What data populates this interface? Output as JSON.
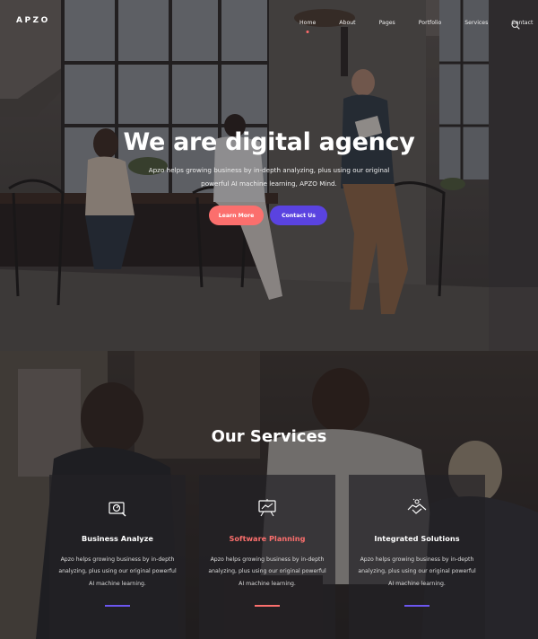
{
  "brand": {
    "logo": "APZO"
  },
  "nav": {
    "items": [
      {
        "label": "Home",
        "active": true
      },
      {
        "label": "About",
        "active": false
      },
      {
        "label": "Pages",
        "active": false
      },
      {
        "label": "Portfolio",
        "active": false
      },
      {
        "label": "Services",
        "active": false
      },
      {
        "label": "Contact",
        "active": false
      }
    ],
    "search_icon": "search-icon"
  },
  "hero": {
    "title": "We are digital agency",
    "description": "Apzo helps growing business by in-depth analyzing, plus using our original powerful AI machine learning, APZO Mind.",
    "learn_more": "Learn More",
    "contact_us": "Contact Us"
  },
  "services": {
    "title": "Our Services",
    "cards": [
      {
        "icon": "analytics-icon",
        "title": "Business Analyze",
        "description": "Apzo helps growing business by in-depth analyzing, plus using our original powerful AI machine learning."
      },
      {
        "icon": "planning-board-icon",
        "title": "Software Planning",
        "description": "Apzo helps growing business by in-depth analyzing, plus using our original powerful AI machine learning."
      },
      {
        "icon": "handshake-icon",
        "title": "Integrated Solutions",
        "description": "Apzo helps growing business by in-depth analyzing, plus using our original powerful AI machine learning."
      }
    ]
  },
  "colors": {
    "accent_red": "#fb6f6d",
    "accent_purple": "#5a43e0"
  }
}
